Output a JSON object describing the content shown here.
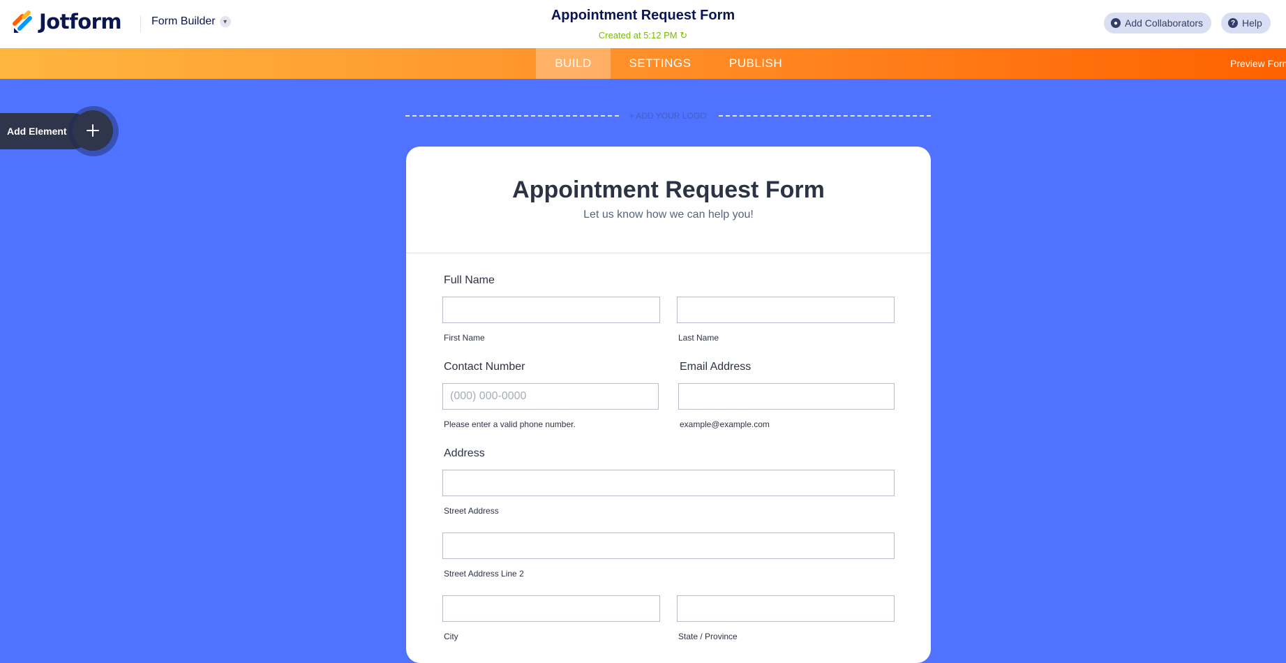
{
  "header": {
    "brand": "Jotform",
    "builder_label": "Form Builder",
    "form_title": "Appointment Request Form",
    "created_text": "Created at 5:12 PM",
    "add_collaborators": "Add Collaborators",
    "help": "Help"
  },
  "nav": {
    "tabs": [
      {
        "label": "BUILD",
        "active": true
      },
      {
        "label": "SETTINGS",
        "active": false
      },
      {
        "label": "PUBLISH",
        "active": false
      }
    ],
    "preview_label": "Preview Form"
  },
  "sidebar": {
    "add_element_label": "Add Element"
  },
  "logo_placeholder": "+ ADD YOUR LOGO",
  "form": {
    "title": "Appointment Request Form",
    "subtitle": "Let us know how we can help you!",
    "full_name": {
      "label": "Full Name",
      "first_sub": "First Name",
      "last_sub": "Last Name"
    },
    "contact": {
      "label": "Contact Number",
      "placeholder": "(000) 000-0000",
      "sub": "Please enter a valid phone number."
    },
    "email": {
      "label": "Email Address",
      "sub": "example@example.com"
    },
    "address": {
      "label": "Address",
      "street_sub": "Street Address",
      "street2_sub": "Street Address Line 2",
      "city_sub": "City",
      "state_sub": "State / Province"
    }
  },
  "colors": {
    "canvas": "#4f73ff",
    "brand_navy": "#0a1551",
    "created_green": "#78bb07",
    "nav_start": "#ffb63f",
    "nav_end": "#ff6100"
  }
}
